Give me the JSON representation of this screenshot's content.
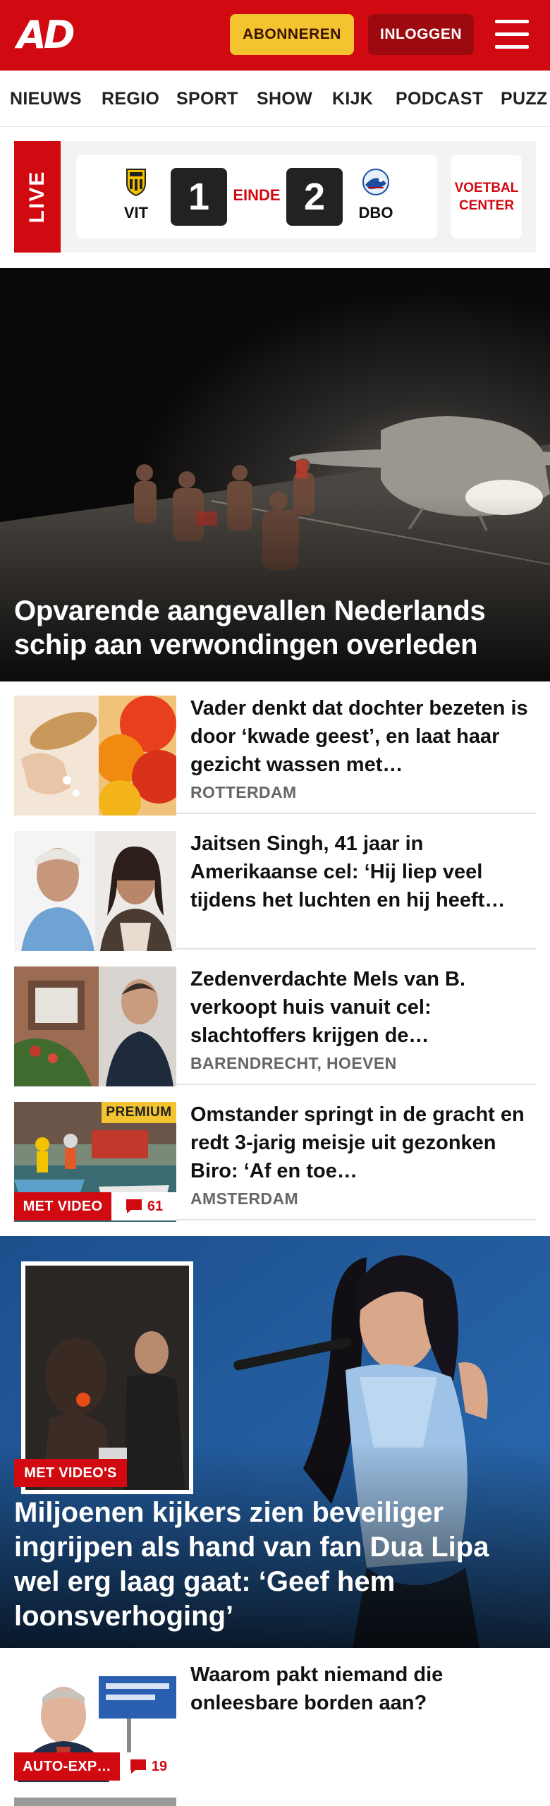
{
  "header": {
    "logo": "AD",
    "subscribe_label": "ABONNEREN",
    "login_label": "INLOGGEN"
  },
  "nav": {
    "items": [
      "NIEUWS",
      "REGIO",
      "SPORT",
      "SHOW",
      "KIJK",
      "PODCAST",
      "PUZZ"
    ]
  },
  "live": {
    "label": "LIVE",
    "home_team": "VIT",
    "home_score": "1",
    "status": "EINDE",
    "away_score": "2",
    "away_team": "DBO",
    "center_label_line1": "VOETBAL",
    "center_label_line2": "CENTER"
  },
  "hero": {
    "title": "Opvarende aangevallen Nederlands schip aan verwondingen overleden"
  },
  "articles": [
    {
      "title": "Vader denkt dat dochter bezeten is door ‘kwade geest’, en laat haar gezicht wassen met…",
      "location": "ROTTERDAM"
    },
    {
      "title": "Jaitsen Singh, 41 jaar in Amerikaanse cel: ‘Hij liep veel tijdens het luchten en hij heeft…",
      "location": ""
    },
    {
      "title": "Zedenverdachte Mels van B. verkoopt huis vanuit cel: slachtoffers krijgen de…",
      "location": "BARENDRECHT, HOEVEN"
    },
    {
      "title": "Omstander springt in de gracht en redt 3-jarig meisje uit gezonken Biro: ‘Af en toe…",
      "location": "AMSTERDAM",
      "premium": "PREMIUM",
      "video_badge": "MET VIDEO",
      "comments": "61"
    }
  ],
  "feature": {
    "badge": "MET VIDEO'S",
    "title": "Miljoenen kijkers zien beveiliger ingrijpen als hand van fan Dua Lipa wel erg laag gaat: ‘Geef hem loonsverhoging’"
  },
  "article5": {
    "title": "Waarom pakt niemand die onleesbare borden aan?",
    "badge": "AUTO-EXP…",
    "comments": "19"
  },
  "colors": {
    "brand_red": "#d10a11",
    "subscribe_yellow": "#f4c430",
    "login_dark_red": "#9c0a10"
  }
}
